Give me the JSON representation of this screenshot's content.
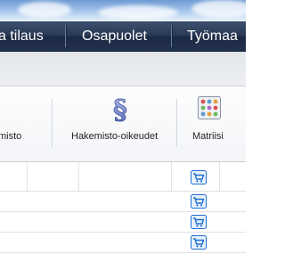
{
  "nav": {
    "items": [
      {
        "label": "a tilaus"
      },
      {
        "label": "Osapuolet"
      },
      {
        "label": "Työmaa"
      }
    ]
  },
  "toolbar": {
    "buttons": [
      {
        "label": "misto",
        "icon": "directory-icon"
      },
      {
        "label": "Hakemisto-oikeudet",
        "icon": "paragraph-icon"
      },
      {
        "label": "Matriisi",
        "icon": "matrix-icon"
      }
    ]
  },
  "table": {
    "row_action_icon": "cart-icon",
    "row_count": 5
  },
  "colors": {
    "nav_bg": "#22324f",
    "accent_blue": "#1e6fd0"
  }
}
